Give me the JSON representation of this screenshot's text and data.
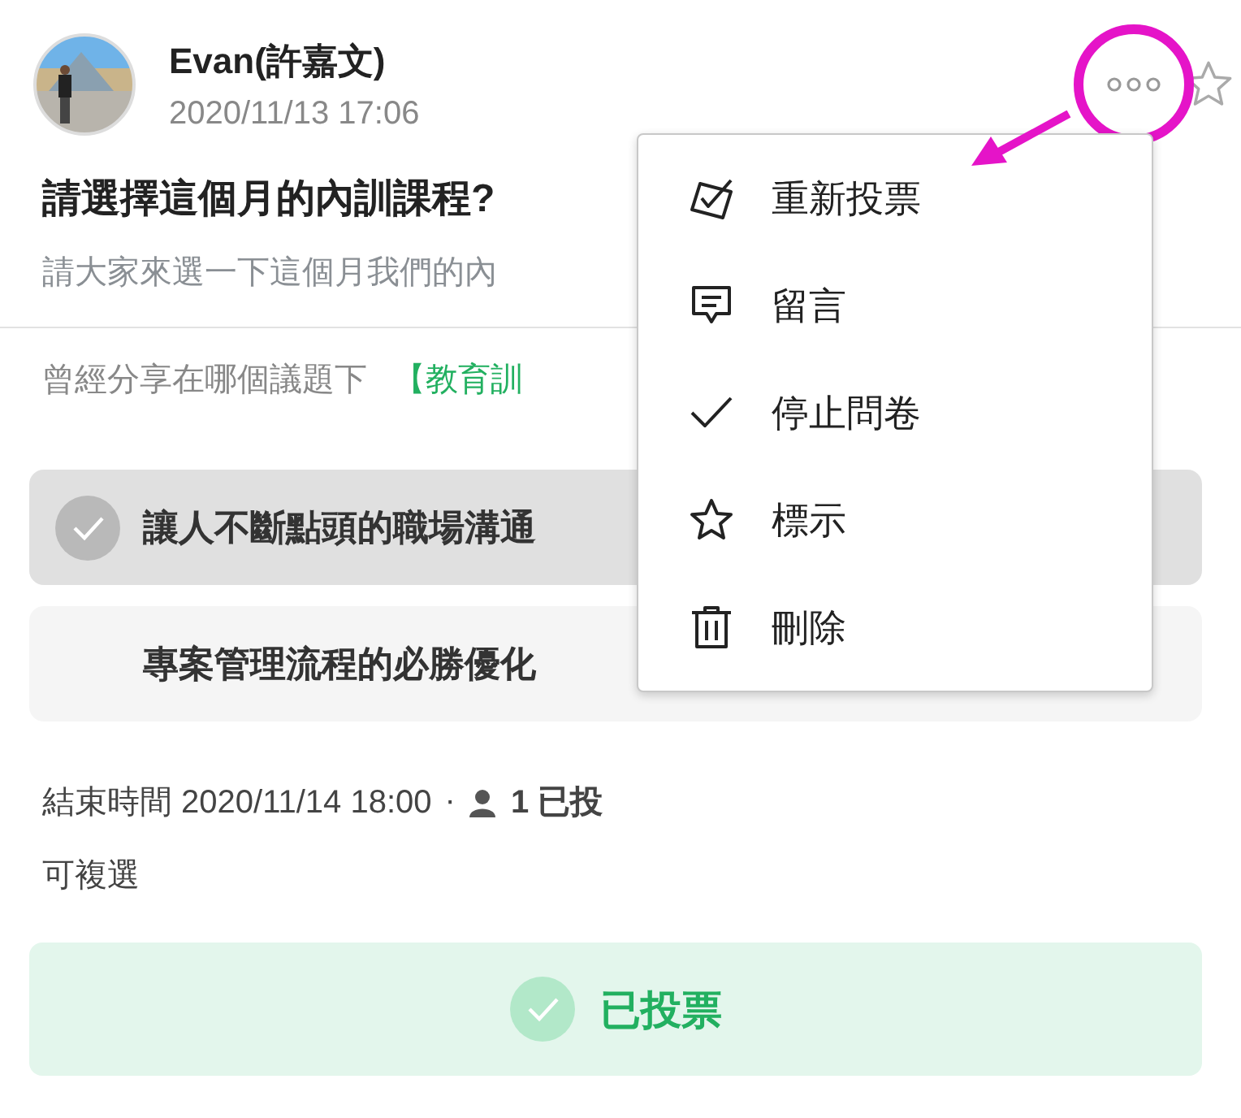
{
  "post": {
    "author": "Evan(許嘉文)",
    "time": "2020/11/13 17:06",
    "title": "請選擇這個月的內訓課程?",
    "description": "請大家來選一下這個月我們的內",
    "topic_label": "曾經分享在哪個議題下",
    "topic": "【教育訓",
    "starred": false
  },
  "options": [
    {
      "text": "讓人不斷點頭的職場溝通",
      "selected": true
    },
    {
      "text": "專案管理流程的必勝優化",
      "selected": false
    }
  ],
  "poll": {
    "end_label": "結束時間 2020/11/14 18:00",
    "separator": "·",
    "voters": "1 已投",
    "multiple": "可複選"
  },
  "vote_button": {
    "label": "已投票",
    "voted": true
  },
  "menu": {
    "open": true,
    "items": [
      {
        "kind": "revote",
        "label": "重新投票"
      },
      {
        "kind": "comment",
        "label": "留言"
      },
      {
        "kind": "stop",
        "label": "停止問卷"
      },
      {
        "kind": "mark",
        "label": "標示"
      },
      {
        "kind": "delete",
        "label": "刪除"
      }
    ]
  }
}
